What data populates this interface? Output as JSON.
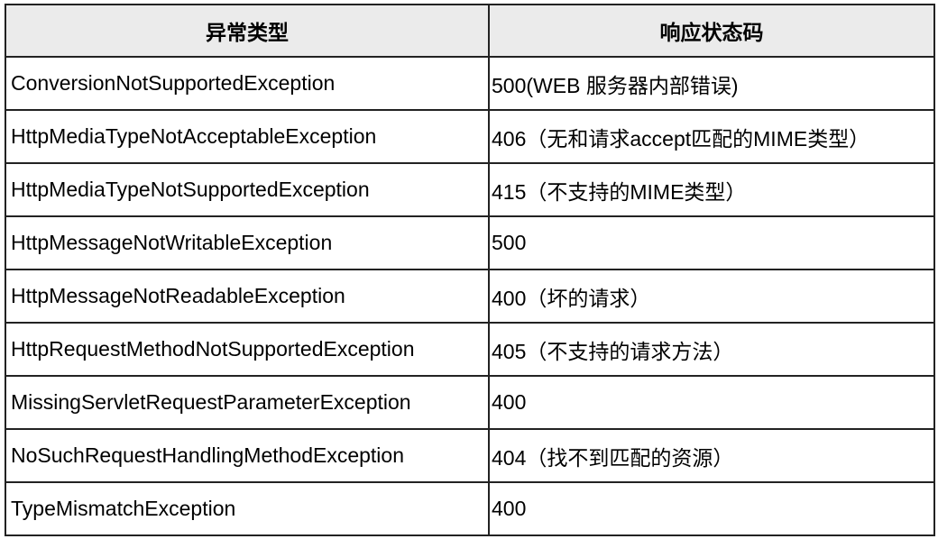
{
  "table": {
    "headers": [
      "异常类型",
      "响应状态码"
    ],
    "rows": [
      {
        "exception": "ConversionNotSupportedException",
        "status": "500(WEB 服务器内部错误)"
      },
      {
        "exception": "HttpMediaTypeNotAcceptableException",
        "status": "406（无和请求accept匹配的MIME类型）"
      },
      {
        "exception": "HttpMediaTypeNotSupportedException",
        "status": "415（不支持的MIME类型）"
      },
      {
        "exception": "HttpMessageNotWritableException",
        "status": "500"
      },
      {
        "exception": "HttpMessageNotReadableException",
        "status": "400（坏的请求）"
      },
      {
        "exception": "HttpRequestMethodNotSupportedException",
        "status": "405（不支持的请求方法）"
      },
      {
        "exception": "MissingServletRequestParameterException",
        "status": "400"
      },
      {
        "exception": "NoSuchRequestHandlingMethodException",
        "status": "404（找不到匹配的资源）"
      },
      {
        "exception": "TypeMismatchException",
        "status": "400"
      }
    ]
  },
  "colors": {
    "header_bg": "#ebebeb",
    "border": "#222222",
    "text": "#000000"
  }
}
